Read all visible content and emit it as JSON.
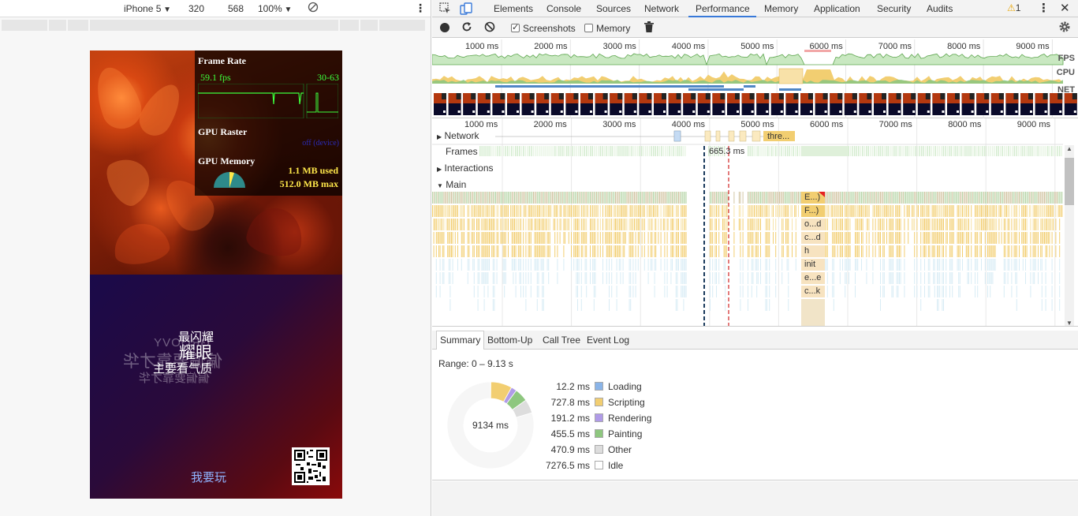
{
  "device_toolbar": {
    "device": "iPhone 5",
    "width": "320",
    "height": "568",
    "zoom": "100%"
  },
  "phone": {
    "hud": {
      "frame_rate_title": "Frame Rate",
      "fps": "59.1 fps",
      "fps_range": "30-63",
      "gpu_raster_title": "GPU Raster",
      "gpu_raster_status": "off (device)",
      "gpu_memory_title": "GPU Memory",
      "gpu_used": "1.1 MB used",
      "gpu_max": "512.0 MB max"
    },
    "text_line1": "最闪耀",
    "text_line2": "耀眼",
    "text_line3": "主要看气质",
    "mirror_line1": "GROOVY",
    "mirror_line2": "偏偏要靠才华",
    "mirror_line3": "偏偏要靠才华",
    "play_link": "我要玩"
  },
  "devtools": {
    "tabs": [
      {
        "label": "Elements"
      },
      {
        "label": "Console"
      },
      {
        "label": "Sources"
      },
      {
        "label": "Network"
      },
      {
        "label": "Performance"
      },
      {
        "label": "Memory"
      },
      {
        "label": "Application"
      },
      {
        "label": "Security"
      },
      {
        "label": "Audits"
      }
    ],
    "active_tab": "Performance",
    "warning_count": "1",
    "perf_toolbar": {
      "screenshots_label": "Screenshots",
      "screenshots_checked": true,
      "memory_label": "Memory",
      "memory_checked": false
    },
    "overview": {
      "ticks": [
        "1000 ms",
        "2000 ms",
        "3000 ms",
        "4000 ms",
        "5000 ms",
        "6000 ms",
        "7000 ms",
        "8000 ms",
        "9000 ms"
      ],
      "fps_label": "FPS",
      "cpu_label": "CPU",
      "net_label": "NET"
    },
    "timeline": {
      "ticks": [
        "1000 ms",
        "2000 ms",
        "3000 ms",
        "4000 ms",
        "5000 ms",
        "6000 ms",
        "7000 ms",
        "8000 ms",
        "9000 ms"
      ],
      "network_label": "Network",
      "network_item": "thre...",
      "frames_label": "Frames",
      "frame_time": "665.3 ms",
      "interactions_label": "Interactions",
      "main_label": "Main",
      "flame_labels": [
        "E...)",
        "F...)",
        "o...d",
        "c...d",
        "h",
        "init",
        "e...e",
        "c...k"
      ]
    },
    "detail_tabs": [
      {
        "label": "Summary"
      },
      {
        "label": "Bottom-Up"
      },
      {
        "label": "Call Tree"
      },
      {
        "label": "Event Log"
      }
    ],
    "summary": {
      "range": "Range: 0 – 9.13 s",
      "total": "9134 ms",
      "rows": [
        {
          "value": "12.2 ms",
          "label": "Loading",
          "color": "#8ab4e8"
        },
        {
          "value": "727.8 ms",
          "label": "Scripting",
          "color": "#f2ce71"
        },
        {
          "value": "191.2 ms",
          "label": "Rendering",
          "color": "#b09be8"
        },
        {
          "value": "455.5 ms",
          "label": "Painting",
          "color": "#8ec77f"
        },
        {
          "value": "470.9 ms",
          "label": "Other",
          "color": "#dddddd"
        },
        {
          "value": "7276.5 ms",
          "label": "Idle",
          "color": "#ffffff"
        }
      ]
    }
  },
  "colors": {
    "accent": "#3879d9",
    "fps_green": "#3cff3c",
    "scripting": "#f2ce71",
    "painting": "#8ec77f",
    "rendering": "#b09be8",
    "loading": "#8ab4e8"
  }
}
